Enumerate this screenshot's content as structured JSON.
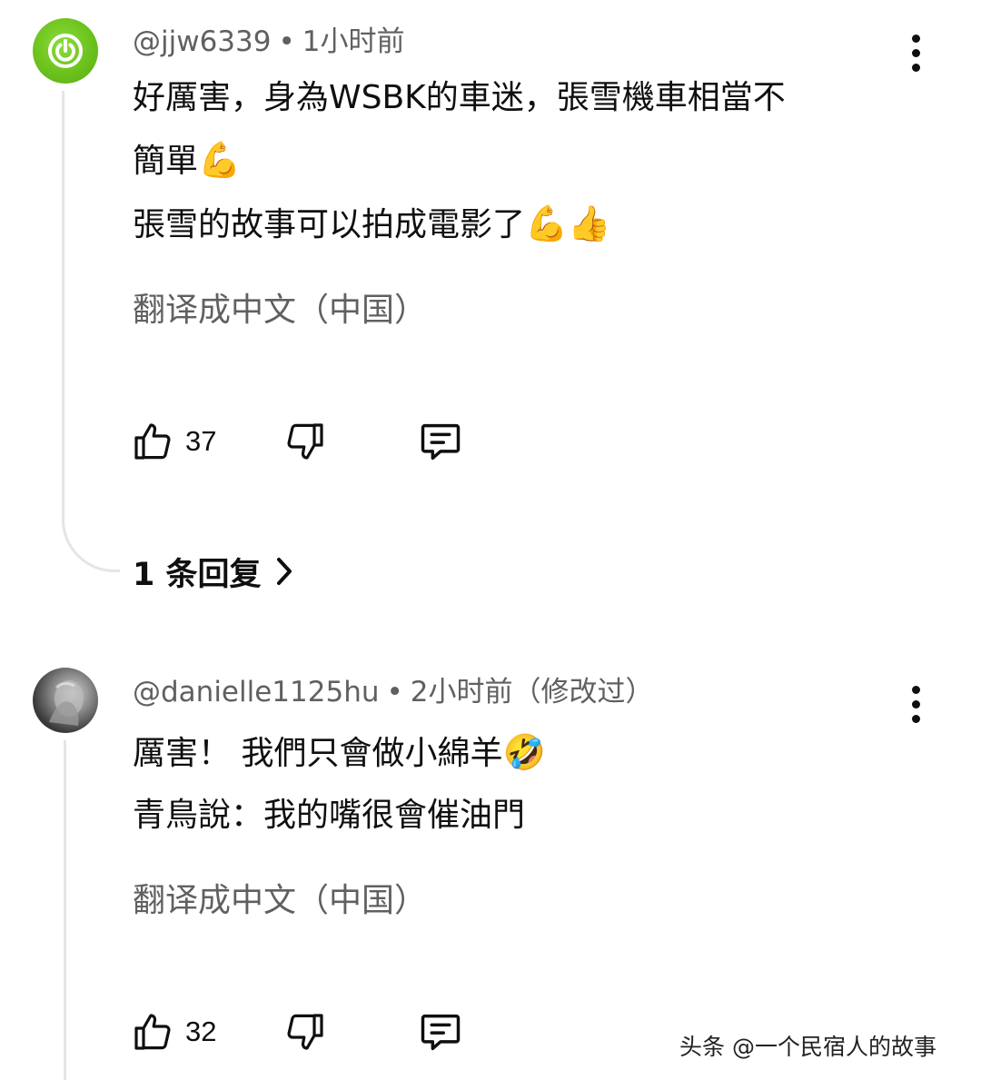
{
  "comments": [
    {
      "author": "@jjw6339",
      "time": "1小时前",
      "edited": "",
      "lines": [
        "好厲害，身為WSBK的車迷，張雪機車相當不",
        "簡單",
        "張雪的故事可以拍成電影了"
      ],
      "emojis": [
        "💪",
        "💪👍"
      ],
      "translate_label": "翻译成中文（中国）",
      "likes": "37",
      "replies_label": "1 条回复"
    },
    {
      "author": "@danielle1125hu",
      "time": "2小时前",
      "edited": "（修改过）",
      "lines": [
        "厲害！ 我們只會做小綿羊",
        "青鳥說：我的嘴很會催油門"
      ],
      "emojis": [
        "🤣"
      ],
      "translate_label": "翻译成中文（中国）",
      "likes": "32"
    }
  ],
  "separator": "•",
  "icons": {
    "like": "thumb-up-icon",
    "dislike": "thumb-down-icon",
    "reply": "comment-icon",
    "more": "more-vert-icon",
    "chevron": "chevron-right-icon",
    "power": "power-icon"
  },
  "watermark": "头条 @一个民宿人的故事",
  "colors": {
    "text": "#0f0f0f",
    "secondary": "#606060",
    "thread": "#e5e5e5",
    "avatar_green": "#6cc21d"
  }
}
